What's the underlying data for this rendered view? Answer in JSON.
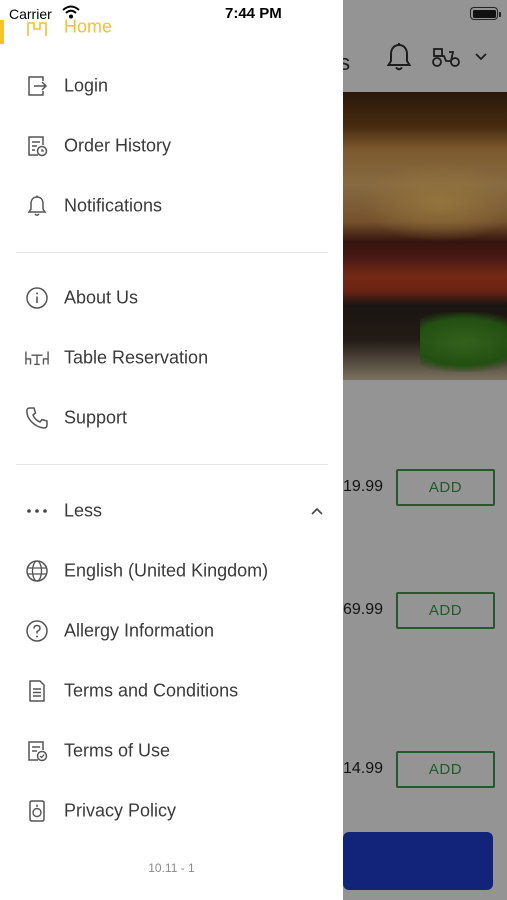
{
  "status_bar": {
    "carrier": "Carrier",
    "time": "7:44 PM"
  },
  "background": {
    "header_fragment": "ts",
    "products": [
      {
        "price": "19.99",
        "add_label": "ADD"
      },
      {
        "price": "69.99",
        "add_label": "ADD"
      },
      {
        "price": "14.99",
        "add_label": "ADD"
      }
    ]
  },
  "drawer": {
    "home": {
      "label": "Home",
      "icon": "home-icon",
      "active": true
    },
    "section1": [
      {
        "label": "Login",
        "icon": "login-icon"
      },
      {
        "label": "Order History",
        "icon": "order-history-icon"
      },
      {
        "label": "Notifications",
        "icon": "bell-icon"
      }
    ],
    "section2": [
      {
        "label": "About Us",
        "icon": "info-icon"
      },
      {
        "label": "Table Reservation",
        "icon": "table-icon"
      },
      {
        "label": "Support",
        "icon": "phone-icon"
      }
    ],
    "less": {
      "label": "Less",
      "icon": "more-dots-icon",
      "expanded": true
    },
    "section3": [
      {
        "label": "English (United Kingdom)",
        "icon": "globe-icon"
      },
      {
        "label": "Allergy Information",
        "icon": "question-icon"
      },
      {
        "label": "Terms and Conditions",
        "icon": "document-icon"
      },
      {
        "label": "Terms of Use",
        "icon": "document-check-icon"
      },
      {
        "label": "Privacy Policy",
        "icon": "privacy-icon"
      }
    ],
    "version": "10.11 - 1"
  },
  "colors": {
    "accent": "#f2c230",
    "add_button": "#3d9a4e",
    "cart_bar": "#1f3fd0",
    "text": "#3a3a3a"
  }
}
